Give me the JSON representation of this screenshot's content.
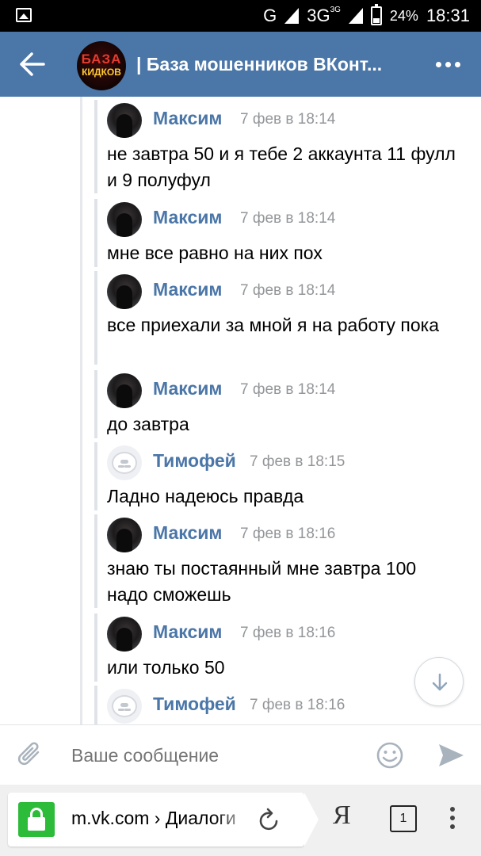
{
  "status_bar": {
    "network_g": "G",
    "network_3g": "3G",
    "network_3g_sup": "3G",
    "battery": "24%",
    "time": "18:31"
  },
  "app_bar": {
    "title": "| База мошенников ВКонт...",
    "avatar_line1": "БАЗА",
    "avatar_line2": "КИДКОВ"
  },
  "messages": [
    {
      "author": "Максим",
      "time": "7 фев в 18:14",
      "text": "не завтра 50 и я тебе 2 аккаунта 11 фулл и 9 полуфул"
    },
    {
      "author": "Максим",
      "time": "7 фев в 18:14",
      "text": "мне все равно на них пох"
    },
    {
      "author": "Максим",
      "time": "7 фев в 18:14",
      "text": "все приехали за мной я на работу пока"
    },
    {
      "author": "Максим",
      "time": "7 фев в 18:14",
      "text": "до завтра"
    },
    {
      "author": "Тимофей",
      "time": "7 фев в 18:15",
      "text": "Ладно надеюсь правда"
    },
    {
      "author": "Максим",
      "time": "7 фев в 18:16",
      "text": "знаю ты постаянный мне завтра 100 надо сможешь"
    },
    {
      "author": "Максим",
      "time": "7 фев в 18:16",
      "text": "или только 50"
    },
    {
      "author": "Тимофей",
      "time": "7 фев в 18:16",
      "text": ""
    }
  ],
  "composer": {
    "placeholder": "Ваше сообщение"
  },
  "browser": {
    "url": "m.vk.com › Диалоги",
    "tabs_count": "1",
    "yandex_label": "Я"
  },
  "colors": {
    "appbar": "#4a76a8",
    "author": "#4a76a8",
    "time": "#939699",
    "lock": "#2dbb3a"
  }
}
